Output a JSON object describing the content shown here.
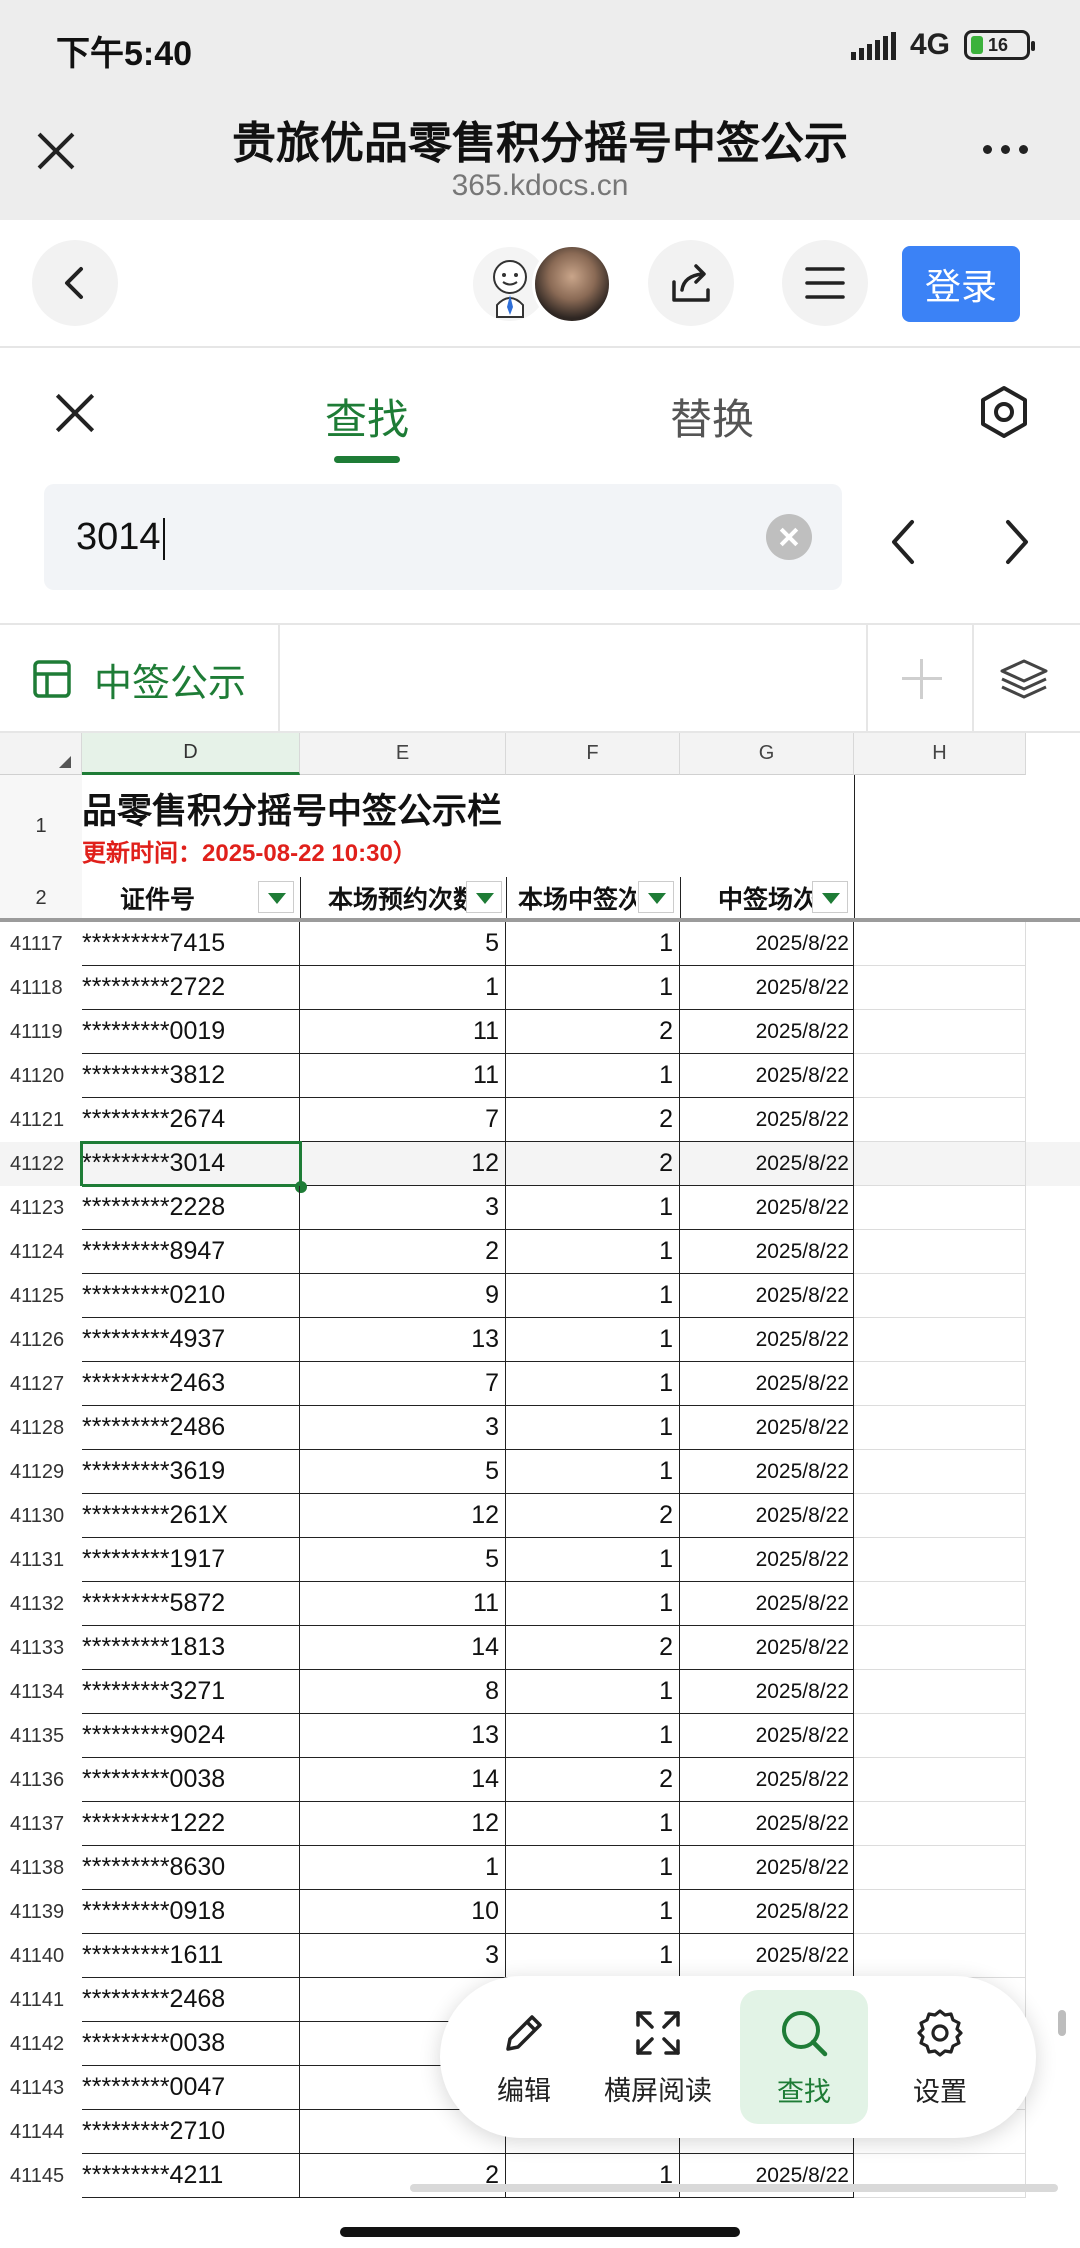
{
  "status_bar": {
    "time": "下午5:40",
    "network": "4G",
    "battery": "16"
  },
  "title_bar": {
    "title": "贵旅优品零售积分摇号中签公示",
    "domain": "365.kdocs.cn"
  },
  "toolbar": {
    "login_label": "登录"
  },
  "find_panel": {
    "tab_find": "查找",
    "tab_replace": "替换",
    "search_value": "3014"
  },
  "sheet_bar": {
    "sheet_name": "中签公示"
  },
  "sheet": {
    "columns": [
      "D",
      "E",
      "F",
      "G",
      "H"
    ],
    "selected_column": "D",
    "banner_row_num": "1",
    "header_row_num": "2",
    "banner_title": "品零售积分摇号中签公示栏",
    "banner_subtitle": "更新时间：2025-08-22 10:30）",
    "headers": {
      "id": "证件号",
      "reserve_count": "本场预约次数",
      "win_count": "本场中签次",
      "win_session": "中签场次"
    },
    "active_row": "41122",
    "rows": [
      {
        "num": "41117",
        "id": "*********7415",
        "e": "5",
        "f": "1",
        "g": "2025/8/22"
      },
      {
        "num": "41118",
        "id": "*********2722",
        "e": "1",
        "f": "1",
        "g": "2025/8/22"
      },
      {
        "num": "41119",
        "id": "*********0019",
        "e": "11",
        "f": "2",
        "g": "2025/8/22"
      },
      {
        "num": "41120",
        "id": "*********3812",
        "e": "11",
        "f": "1",
        "g": "2025/8/22"
      },
      {
        "num": "41121",
        "id": "*********2674",
        "e": "7",
        "f": "2",
        "g": "2025/8/22"
      },
      {
        "num": "41122",
        "id": "*********3014",
        "e": "12",
        "f": "2",
        "g": "2025/8/22"
      },
      {
        "num": "41123",
        "id": "*********2228",
        "e": "3",
        "f": "1",
        "g": "2025/8/22"
      },
      {
        "num": "41124",
        "id": "*********8947",
        "e": "2",
        "f": "1",
        "g": "2025/8/22"
      },
      {
        "num": "41125",
        "id": "*********0210",
        "e": "9",
        "f": "1",
        "g": "2025/8/22"
      },
      {
        "num": "41126",
        "id": "*********4937",
        "e": "13",
        "f": "1",
        "g": "2025/8/22"
      },
      {
        "num": "41127",
        "id": "*********2463",
        "e": "7",
        "f": "1",
        "g": "2025/8/22"
      },
      {
        "num": "41128",
        "id": "*********2486",
        "e": "3",
        "f": "1",
        "g": "2025/8/22"
      },
      {
        "num": "41129",
        "id": "*********3619",
        "e": "5",
        "f": "1",
        "g": "2025/8/22"
      },
      {
        "num": "41130",
        "id": "*********261X",
        "e": "12",
        "f": "2",
        "g": "2025/8/22"
      },
      {
        "num": "41131",
        "id": "*********1917",
        "e": "5",
        "f": "1",
        "g": "2025/8/22"
      },
      {
        "num": "41132",
        "id": "*********5872",
        "e": "11",
        "f": "1",
        "g": "2025/8/22"
      },
      {
        "num": "41133",
        "id": "*********1813",
        "e": "14",
        "f": "2",
        "g": "2025/8/22"
      },
      {
        "num": "41134",
        "id": "*********3271",
        "e": "8",
        "f": "1",
        "g": "2025/8/22"
      },
      {
        "num": "41135",
        "id": "*********9024",
        "e": "13",
        "f": "1",
        "g": "2025/8/22"
      },
      {
        "num": "41136",
        "id": "*********0038",
        "e": "14",
        "f": "2",
        "g": "2025/8/22"
      },
      {
        "num": "41137",
        "id": "*********1222",
        "e": "12",
        "f": "1",
        "g": "2025/8/22"
      },
      {
        "num": "41138",
        "id": "*********8630",
        "e": "1",
        "f": "1",
        "g": "2025/8/22"
      },
      {
        "num": "41139",
        "id": "*********0918",
        "e": "10",
        "f": "1",
        "g": "2025/8/22"
      },
      {
        "num": "41140",
        "id": "*********1611",
        "e": "3",
        "f": "1",
        "g": "2025/8/22"
      },
      {
        "num": "41141",
        "id": "*********2468",
        "e": "",
        "f": "",
        "g": ""
      },
      {
        "num": "41142",
        "id": "*********0038",
        "e": "",
        "f": "",
        "g": ""
      },
      {
        "num": "41143",
        "id": "*********0047",
        "e": "",
        "f": "",
        "g": ""
      },
      {
        "num": "41144",
        "id": "*********2710",
        "e": "",
        "f": "",
        "g": ""
      },
      {
        "num": "41145",
        "id": "*********4211",
        "e": "2",
        "f": "1",
        "g": "2025/8/22"
      }
    ]
  },
  "action_bar": {
    "edit": "编辑",
    "landscape": "横屏阅读",
    "find": "查找",
    "settings": "设置"
  },
  "icons": {
    "close": "close-icon",
    "more": "more-icon",
    "back": "chevron-left-icon",
    "share": "share-icon",
    "menu": "menu-icon",
    "gear": "gear-hex-icon",
    "clear": "clear-icon",
    "prev": "chevron-left-icon",
    "next": "chevron-right-icon",
    "sheet": "table-icon",
    "add": "plus-icon",
    "layers": "layers-icon",
    "edit": "pencil-icon",
    "landscape": "expand-icon",
    "find": "search-icon",
    "settings": "gear-icon"
  },
  "colors": {
    "accent_green": "#1e7c36",
    "login_blue": "#3b82f6",
    "banner_red": "#e0201b"
  }
}
